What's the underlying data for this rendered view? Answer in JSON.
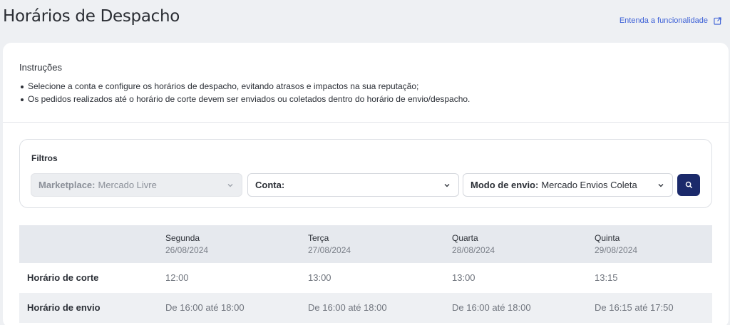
{
  "header": {
    "title": "Horários de Despacho",
    "help_link": "Entenda a funcionalidade"
  },
  "instructions": {
    "title": "Instruções",
    "items": [
      "Selecione a conta e configure os horários de despacho, evitando atrasos e impactos na sua reputação;",
      "Os pedidos realizados até o horário de corte devem ser enviados ou coletados dentro do horário de envio/despacho."
    ]
  },
  "filters": {
    "title": "Filtros",
    "marketplace": {
      "label": "Marketplace:",
      "value": "Mercado Livre"
    },
    "conta": {
      "label": "Conta:",
      "value": ""
    },
    "modo_envio": {
      "label": "Modo de envio:",
      "value": "Mercado Envios Coleta"
    },
    "search_icon": "search-icon"
  },
  "schedule": {
    "days": [
      {
        "name": "Segunda",
        "date": "26/08/2024"
      },
      {
        "name": "Terça",
        "date": "27/08/2024"
      },
      {
        "name": "Quarta",
        "date": "28/08/2024"
      },
      {
        "name": "Quinta",
        "date": "29/08/2024"
      }
    ],
    "rows": [
      {
        "label": "Horário de corte",
        "values": [
          "12:00",
          "13:00",
          "13:00",
          "13:15"
        ]
      },
      {
        "label": "Horário de envio",
        "values": [
          "De 16:00 até 18:00",
          "De 16:00 até 18:00",
          "De 16:00 até 18:00",
          "De 16:15 até 17:50"
        ]
      }
    ]
  },
  "colors": {
    "accent": "#1b2a6b",
    "link": "#3b5fd6",
    "background": "#eef0f3"
  }
}
